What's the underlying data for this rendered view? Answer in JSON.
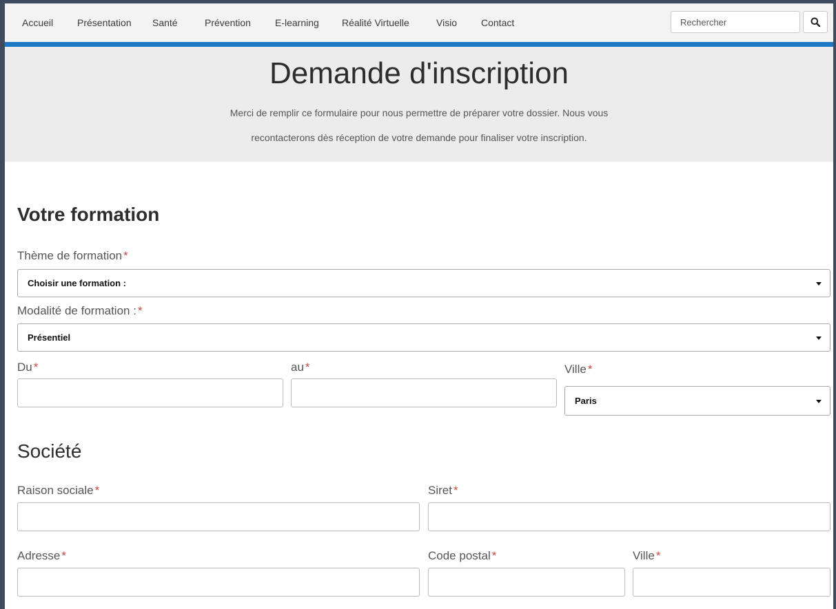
{
  "nav": {
    "items": [
      "Accueil",
      "Présentation",
      "Santé",
      "Prévention",
      "E-learning",
      "Réalité Virtuelle",
      "Visio",
      "Contact"
    ],
    "search_placeholder": "Rechercher",
    "search_icon": "search-icon"
  },
  "hero": {
    "title": "Demande d'inscription",
    "line1": "Merci de remplir ce formulaire pour nous permettre de préparer votre dossier. Nous vous",
    "line2": "recontacterons dès réception de votre demande pour finaliser votre inscription."
  },
  "formation": {
    "title": "Votre formation",
    "theme_label": "Thème de formation",
    "theme_value": "Choisir une formation :",
    "modalite_label": "Modalité de formation :",
    "modalite_value": "Présentiel",
    "du_label": "Du",
    "au_label": "au",
    "ville_label": "Ville",
    "ville_value": "Paris"
  },
  "societe": {
    "title": "Société",
    "raison_label": "Raison sociale",
    "siret_label": "Siret",
    "adresse_label": "Adresse",
    "cp_label": "Code postal",
    "ville_label": "Ville"
  },
  "required_marker": "*",
  "colors": {
    "accent": "#1b76c4",
    "required": "#c9473f",
    "frame": "#3f4c60"
  }
}
